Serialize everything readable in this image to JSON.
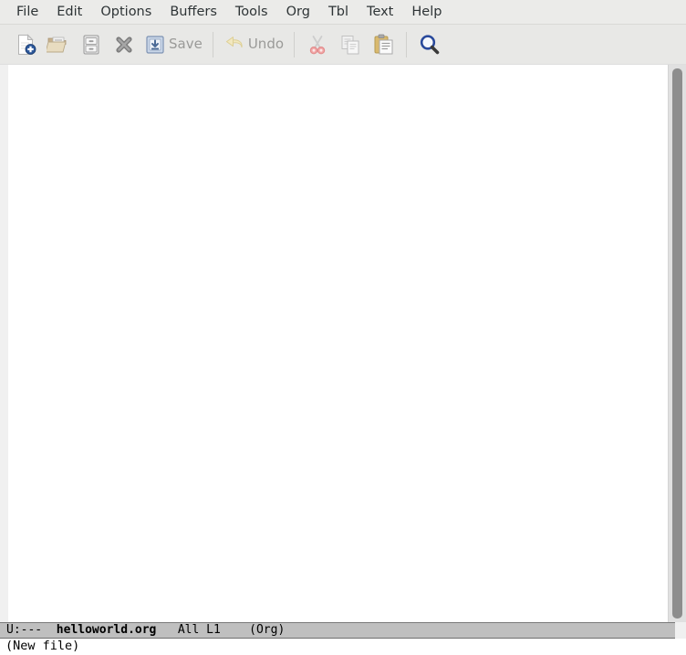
{
  "window": {
    "title": "helloworld.org",
    "app": "Emacs"
  },
  "menubar": {
    "items": [
      {
        "label": "File",
        "name": "menu-file"
      },
      {
        "label": "Edit",
        "name": "menu-edit"
      },
      {
        "label": "Options",
        "name": "menu-options"
      },
      {
        "label": "Buffers",
        "name": "menu-buffers"
      },
      {
        "label": "Tools",
        "name": "menu-tools"
      },
      {
        "label": "Org",
        "name": "menu-org"
      },
      {
        "label": "Tbl",
        "name": "menu-tbl"
      },
      {
        "label": "Text",
        "name": "menu-text"
      },
      {
        "label": "Help",
        "name": "menu-help"
      }
    ]
  },
  "toolbar": {
    "new_file_icon": "new-file-icon",
    "open_file_icon": "open-folder-icon",
    "save_as_icon": "file-cabinet-icon",
    "close_icon": "close-x-icon",
    "save_icon": "save-floppy-icon",
    "save_label": "Save",
    "undo_icon": "undo-arrow-icon",
    "undo_label": "Undo",
    "cut_icon": "scissors-icon",
    "copy_icon": "copy-pages-icon",
    "paste_icon": "clipboard-paste-icon",
    "search_icon": "magnifier-icon"
  },
  "buffer": {
    "content": "",
    "cursor_line": 1,
    "cursor_column": 0
  },
  "scrollbar": {
    "name": "vertical-scrollbar",
    "thumb_position_percent": 0,
    "thumb_size_percent": 100
  },
  "modeline": {
    "status": "U:---",
    "buffer_name": "helloworld.org",
    "position": "All",
    "line": "L1",
    "major_mode": "(Org)",
    "gap1": "  ",
    "gap2": "   ",
    "gap3": "    "
  },
  "echo_area": {
    "message": "(New file)"
  },
  "colors": {
    "menubar_bg": "#ebebe9",
    "toolbar_bg": "#e8e8e6",
    "buffer_bg": "#ffffff",
    "fringe_bg": "#f0f0f0",
    "modeline_bg": "#bfbfbf",
    "scrollbar_track": "#e0e0e0",
    "scrollbar_thumb": "#8d8d8d",
    "text_fg": "#000000",
    "disabled_fg": "#9a9a98"
  }
}
